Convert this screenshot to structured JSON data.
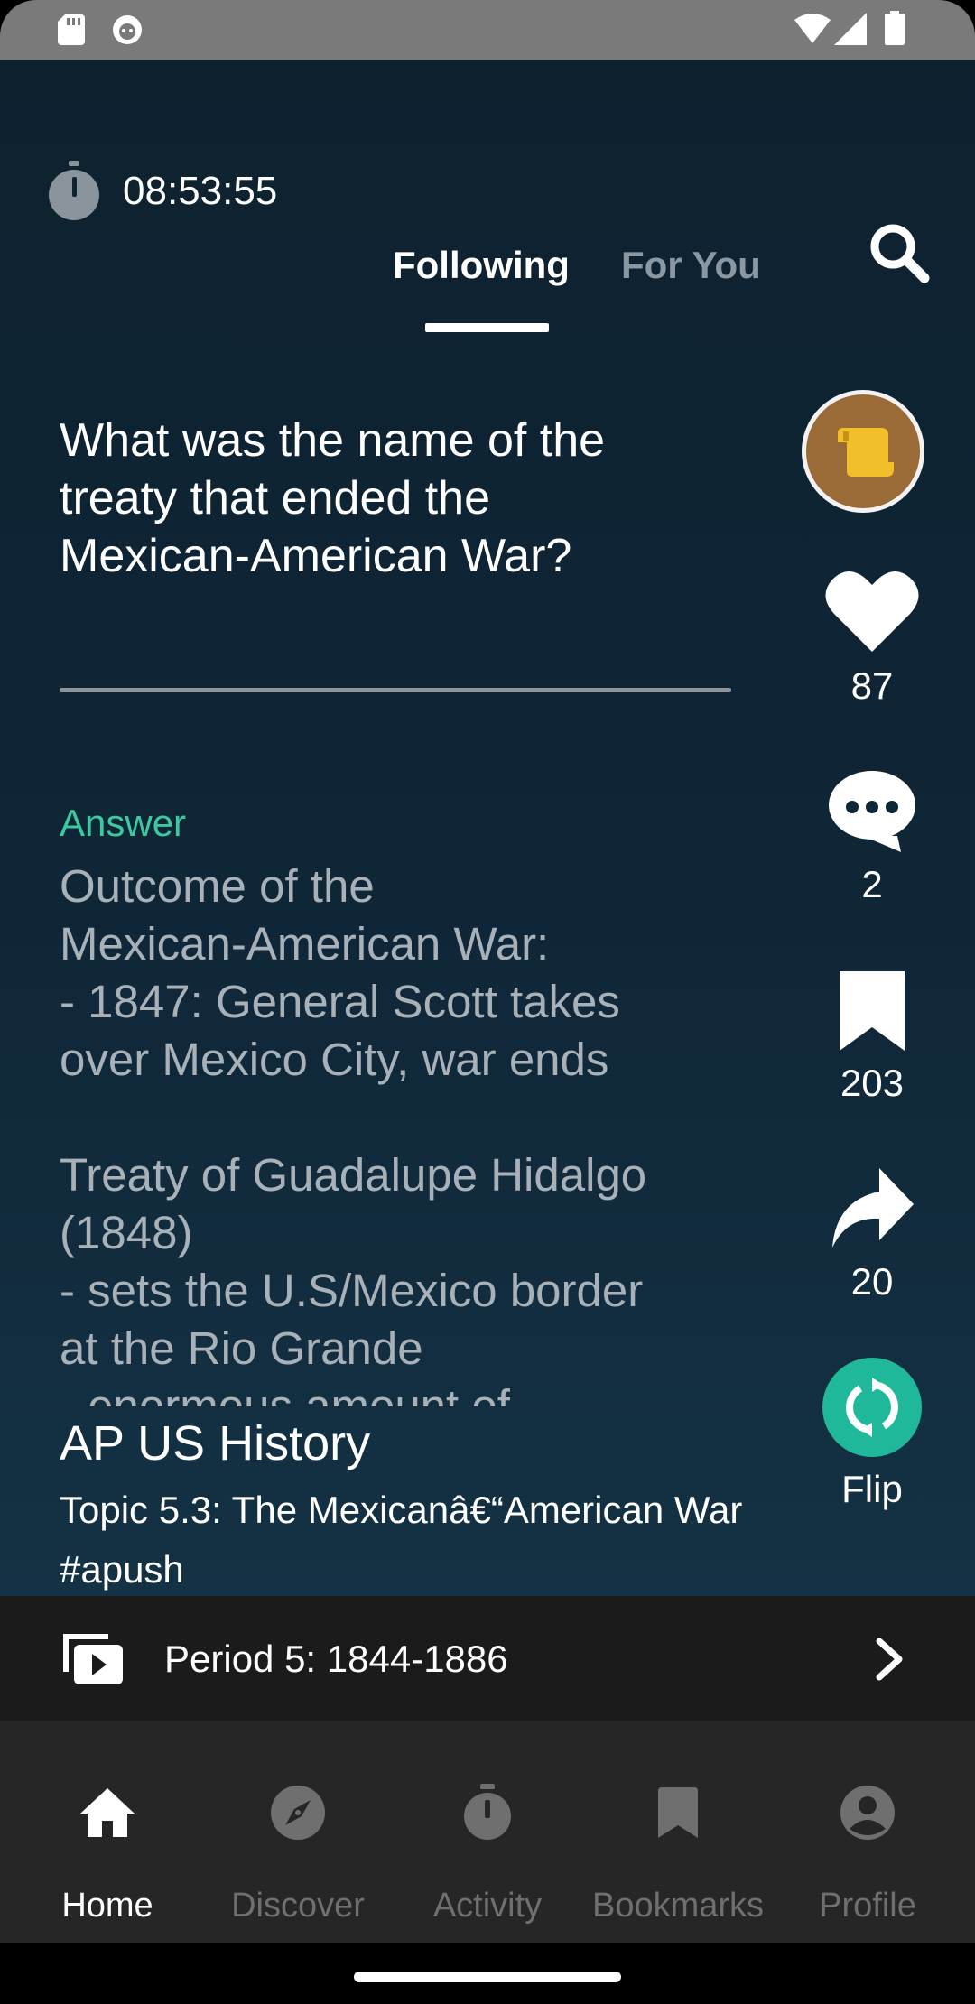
{
  "status_bar": {
    "icons": [
      "sd-card-icon",
      "notification-app-icon",
      "wifi-icon",
      "signal-icon",
      "battery-icon"
    ]
  },
  "header": {
    "timer": "08:53:55",
    "tabs": [
      {
        "label": "Following",
        "active": true
      },
      {
        "label": "For You",
        "active": false
      }
    ]
  },
  "card": {
    "question": "What was the name of the treaty that ended the Mexican-American War?",
    "answer_label": "Answer",
    "answer_text": "Outcome of the\nMexican-American War:\n- 1847: General Scott takes\nover Mexico City, war ends\n\nTreaty of Guadalupe Hidalgo\n(1848)\n- sets the U.S/Mexico border\nat the Rio Grande\n- enormous amount of",
    "deck_title": "AP US History",
    "deck_topic": "Topic 5.3: The Mexicanâ€“American War #apush"
  },
  "actions": {
    "likes": "87",
    "comments": "2",
    "bookmarks": "203",
    "shares": "20",
    "flip_label": "Flip"
  },
  "playlist": {
    "label": "Period 5: 1844-1886"
  },
  "bottom_nav": [
    {
      "label": "Home",
      "icon": "home-icon",
      "active": true
    },
    {
      "label": "Discover",
      "icon": "compass-icon",
      "active": false
    },
    {
      "label": "Activity",
      "icon": "stopwatch-icon",
      "active": false
    },
    {
      "label": "Bookmarks",
      "icon": "bookmark-icon",
      "active": false
    },
    {
      "label": "Profile",
      "icon": "account-circle-icon",
      "active": false
    }
  ],
  "colors": {
    "accent": "#3cc9a0",
    "flip_button": "#1fb89a",
    "background": "#0f2637",
    "inactive_nav": "#6f6f6f"
  }
}
